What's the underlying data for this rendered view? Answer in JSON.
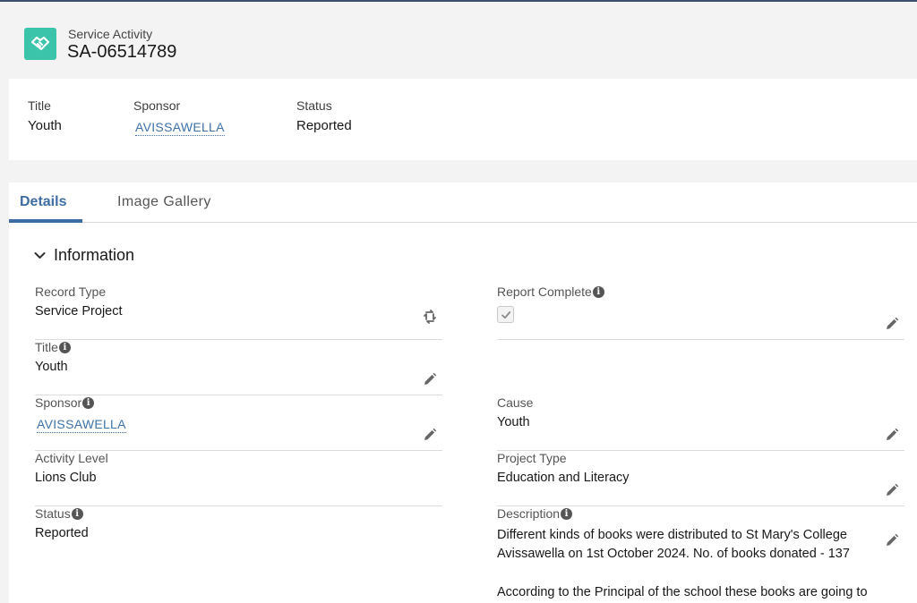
{
  "header": {
    "object_type": "Service Activity",
    "record_name": "SA-06514789",
    "icon": "handshake-icon",
    "icon_color": "#3bc4aa"
  },
  "highlights": [
    {
      "label": "Title",
      "value": "Youth"
    },
    {
      "label": "Sponsor",
      "value": "AVISSAWELLA"
    },
    {
      "label": "Status",
      "value": "Reported"
    }
  ],
  "tabs": [
    {
      "label": "Details",
      "active": true
    },
    {
      "label": "Image Gallery",
      "active": false
    }
  ],
  "section": {
    "title": "Information",
    "expanded": true
  },
  "fields": {
    "record_type": {
      "label": "Record Type",
      "value": "Service Project"
    },
    "report_complete": {
      "label": "Report Complete",
      "checked": true
    },
    "title": {
      "label": "Title",
      "value": "Youth"
    },
    "sponsor": {
      "label": "Sponsor",
      "value": "AVISSAWELLA"
    },
    "cause": {
      "label": "Cause",
      "value": "Youth"
    },
    "activity_level": {
      "label": "Activity Level",
      "value": "Lions Club"
    },
    "project_type": {
      "label": "Project Type",
      "value": "Education and Literacy"
    },
    "status": {
      "label": "Status",
      "value": "Reported"
    },
    "description": {
      "label": "Description",
      "paragraph1": "Different kinds of books were distributed to St Mary's College Avissawella on 1st October 2024. No. of books donated - 137",
      "paragraph2": "According to the Principal of the school these books are going to"
    }
  },
  "colors": {
    "link": "#3f72a8",
    "tab_active": "#3e6da3",
    "top_border": "#3e4f6f"
  }
}
